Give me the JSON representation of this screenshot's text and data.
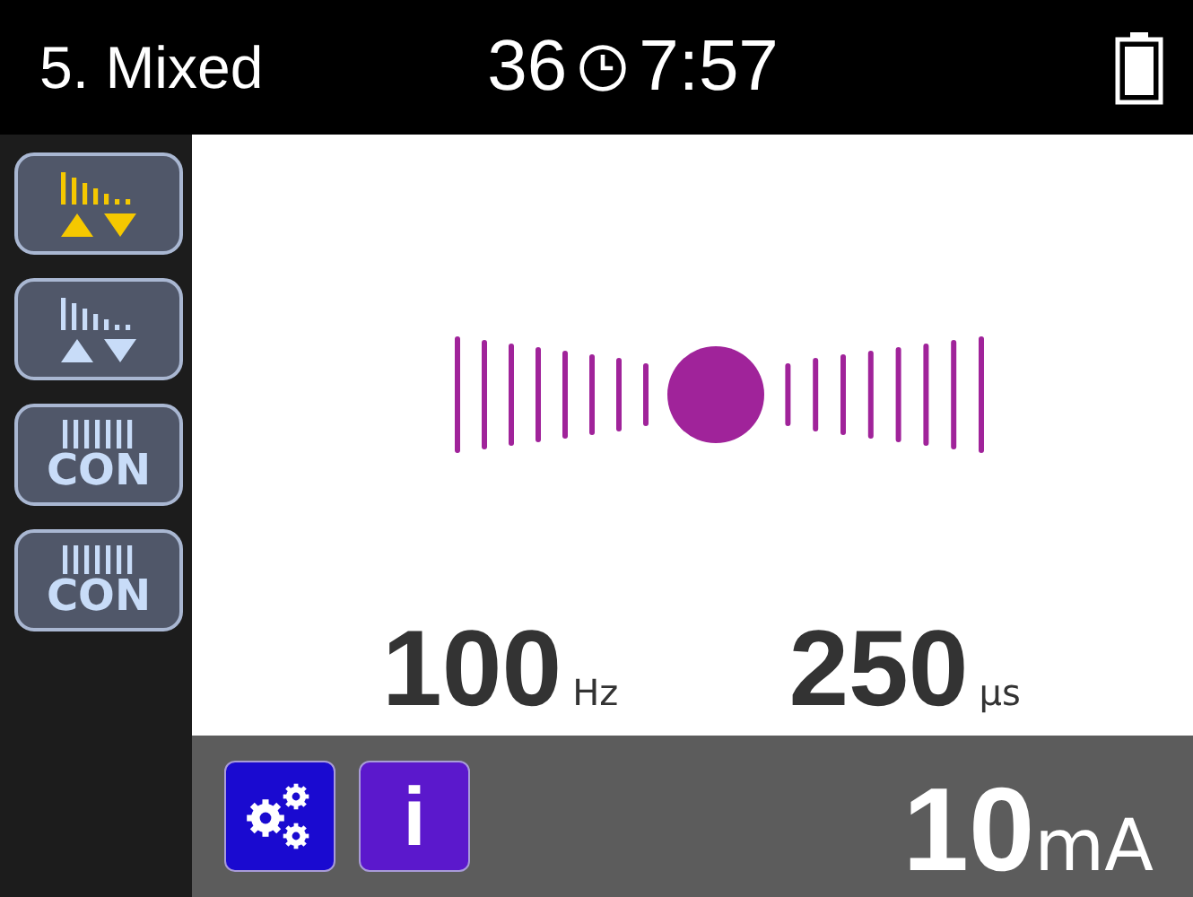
{
  "header": {
    "title": "5. Mixed",
    "count": "36",
    "time": "7:57"
  },
  "sidebar": {
    "buttons": [
      {
        "kind": "ramp",
        "selected": true
      },
      {
        "kind": "ramp",
        "selected": false
      },
      {
        "kind": "con",
        "label": "CON",
        "selected": false
      },
      {
        "kind": "con",
        "label": "CON",
        "selected": false
      }
    ]
  },
  "readings": [
    {
      "value": "100",
      "unit": "Hz"
    },
    {
      "value": "250",
      "unit": "µs"
    }
  ],
  "footer": {
    "buttons": [
      {
        "kind": "settings"
      },
      {
        "kind": "info",
        "label": "i"
      }
    ],
    "current": {
      "value": "10",
      "unit": "mA"
    }
  }
}
